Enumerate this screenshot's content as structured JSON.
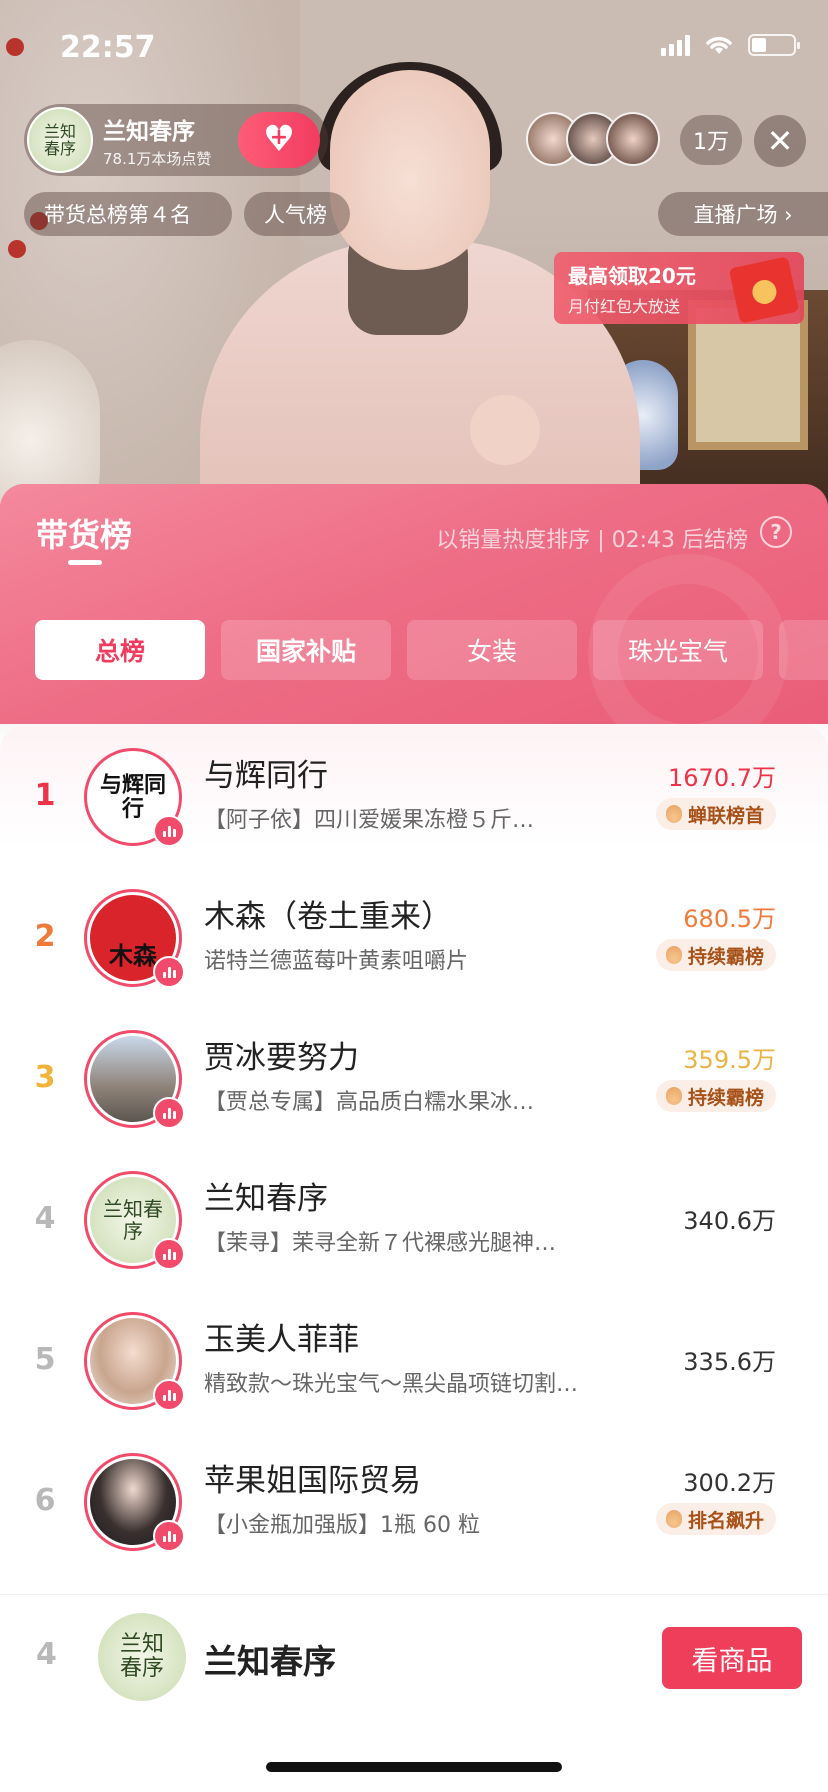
{
  "status_bar": {
    "time": "22:57"
  },
  "host": {
    "name": "兰知春序",
    "likes": "78.1万本场点赞",
    "avatar_text_line1": "兰知",
    "avatar_text_line2": "春序"
  },
  "viewer_count": "1万",
  "tags": {
    "rank": "带货总榜第４名",
    "popularity": "人气榜",
    "plaza": "直播广场 ›"
  },
  "red_packet": {
    "title": "最高领取20元",
    "subtitle": "月付红包大放送"
  },
  "sheet": {
    "title": "带货榜",
    "sort_note": "以销量热度排序 | 02:43 后结榜",
    "help": "?",
    "tabs": [
      "总榜",
      "国家补贴",
      "女装",
      "珠光宝气"
    ]
  },
  "rankings": [
    {
      "rank": "1",
      "name": "与辉同行",
      "product": "【阿子依】四川爱媛果冻橙５斤…",
      "sales": "1670.7万",
      "badge": "蝉联榜首",
      "avatar_text": "与辉同行"
    },
    {
      "rank": "2",
      "name": "木森（卷土重来）",
      "product": "诺特兰德蓝莓叶黄素咀嚼片",
      "sales": "680.5万",
      "badge": "持续霸榜",
      "avatar_text": "木森"
    },
    {
      "rank": "3",
      "name": "贾冰要努力",
      "product": "【贾总专属】高品质白糯水果冰…",
      "sales": "359.5万",
      "badge": "持续霸榜",
      "avatar_text": ""
    },
    {
      "rank": "4",
      "name": "兰知春序",
      "product": "【茉寻】茉寻全新７代裸感光腿神…",
      "sales": "340.6万",
      "badge": "",
      "avatar_text": "兰知春序"
    },
    {
      "rank": "5",
      "name": "玉美人菲菲",
      "product": "精致款～珠光宝气～黑尖晶项链切割…",
      "sales": "335.6万",
      "badge": "",
      "avatar_text": ""
    },
    {
      "rank": "6",
      "name": "苹果姐国际贸易",
      "product": "【小金瓶加强版】1瓶 60 粒",
      "sales": "300.2万",
      "badge": "排名飙升",
      "avatar_text": ""
    }
  ],
  "self": {
    "rank": "4",
    "name": "兰知春序",
    "avatar_text_line1": "兰知",
    "avatar_text_line2": "春序",
    "button": "看商品"
  },
  "colors": {
    "accent": "#ef3e5a",
    "sheet_pink": "#ee6d86",
    "rank1": "#ee3348",
    "rank2": "#f07a3a",
    "rank3": "#f2b33b"
  },
  "icons": [
    "signal-icon",
    "wifi-icon",
    "battery-icon",
    "heart-plus-icon",
    "close-icon",
    "chevron-right-icon",
    "help-icon",
    "live-bars-icon",
    "flame-icon"
  ]
}
